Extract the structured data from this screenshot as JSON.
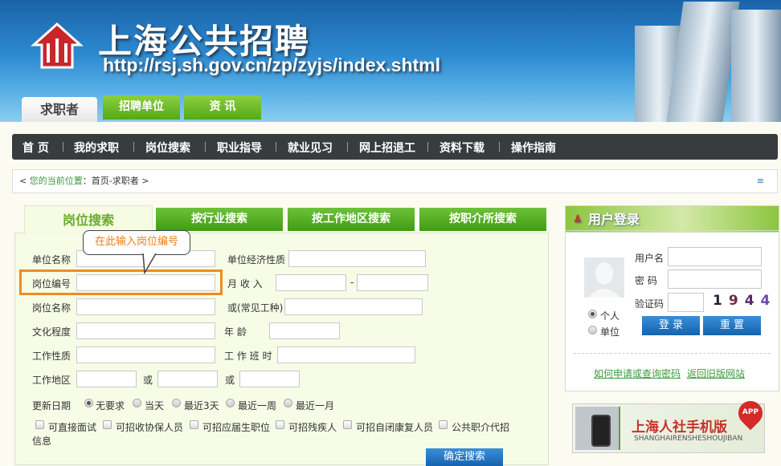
{
  "header": {
    "title": "上海公共招聘",
    "url": "http://rsj.sh.gov.cn/zp/zyjs/index.shtml",
    "tabs": [
      "求职者",
      "招聘单位",
      "资 讯"
    ]
  },
  "nav": [
    "首 页",
    "我的求职",
    "岗位搜索",
    "职业指导",
    "就业见习",
    "网上招退工",
    "资料下载",
    "操作指南"
  ],
  "breadcrumb": {
    "prefix": "<",
    "label": "您的当前位置",
    "sep": "：",
    "path": "首页-求职者",
    "suffix": ">"
  },
  "search_tabs": [
    "岗位搜索",
    "按行业搜索",
    "按工作地区搜索",
    "按职介所搜索"
  ],
  "tooltip": "在此输入岗位编号",
  "form": {
    "unit_name": "单位名称",
    "unit_type": "单位经济性质",
    "job_id": "岗位编号",
    "income": "月 收 入",
    "dash": "-",
    "job_name": "岗位名称",
    "common_job": "或(常见工种)",
    "education": "文化程度",
    "age": "年 龄",
    "job_nature": "工作性质",
    "shift": "工 作 班 时",
    "area": "工作地区",
    "or": "或",
    "update_label": "更新日期",
    "update_options": [
      "无要求",
      "当天",
      "最近3天",
      "最近一周",
      "最近一月"
    ],
    "update_selected": "无要求",
    "checkboxes": [
      "可直接面试",
      "可招收协保人员",
      "可招应届生职位",
      "可招残疾人",
      "可招自闭康复人员",
      "公共职介代招"
    ],
    "checkbox_wrap": "信息",
    "submit": "确定搜索"
  },
  "login": {
    "title": "用户登录",
    "username": "用户名",
    "password": "密 码",
    "captcha_label": "验证码",
    "captcha": [
      "1",
      "9",
      "4",
      "4"
    ],
    "roles": [
      "个人",
      "单位"
    ],
    "role_selected": "个人",
    "login_btn": "登 录",
    "reset_btn": "重 置",
    "links": [
      "如何申请或查询密码",
      "返回旧版网站"
    ]
  },
  "banner": {
    "title": "上海人社手机版",
    "subtitle": "SHANGHAIRENSHESHOUJIBAN",
    "badge": "APP"
  },
  "colors": {
    "accent_green": "#55a818",
    "nav_dark": "#393c3f",
    "highlight": "#f08a24",
    "button_blue": "#1463b0"
  }
}
